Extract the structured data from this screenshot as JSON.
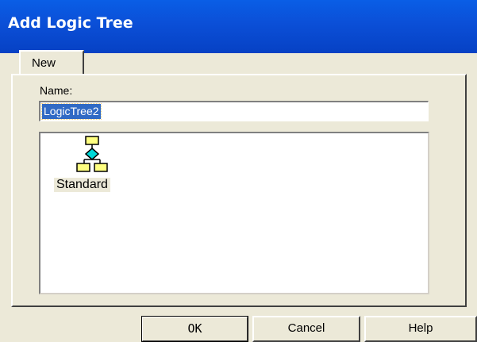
{
  "window": {
    "title": "Add Logic Tree"
  },
  "tabs": [
    {
      "label": "New"
    }
  ],
  "name_field": {
    "label": "Name:",
    "value": "LogicTree2"
  },
  "items": [
    {
      "label": "Standard",
      "icon": "tree-diagram-icon"
    }
  ],
  "buttons": {
    "ok": "OK",
    "cancel": "Cancel",
    "help": "Help"
  },
  "colors": {
    "title_bar": "#0b4fd7",
    "selection": "#316ac5",
    "dialog_bg": "#ece9d8"
  }
}
